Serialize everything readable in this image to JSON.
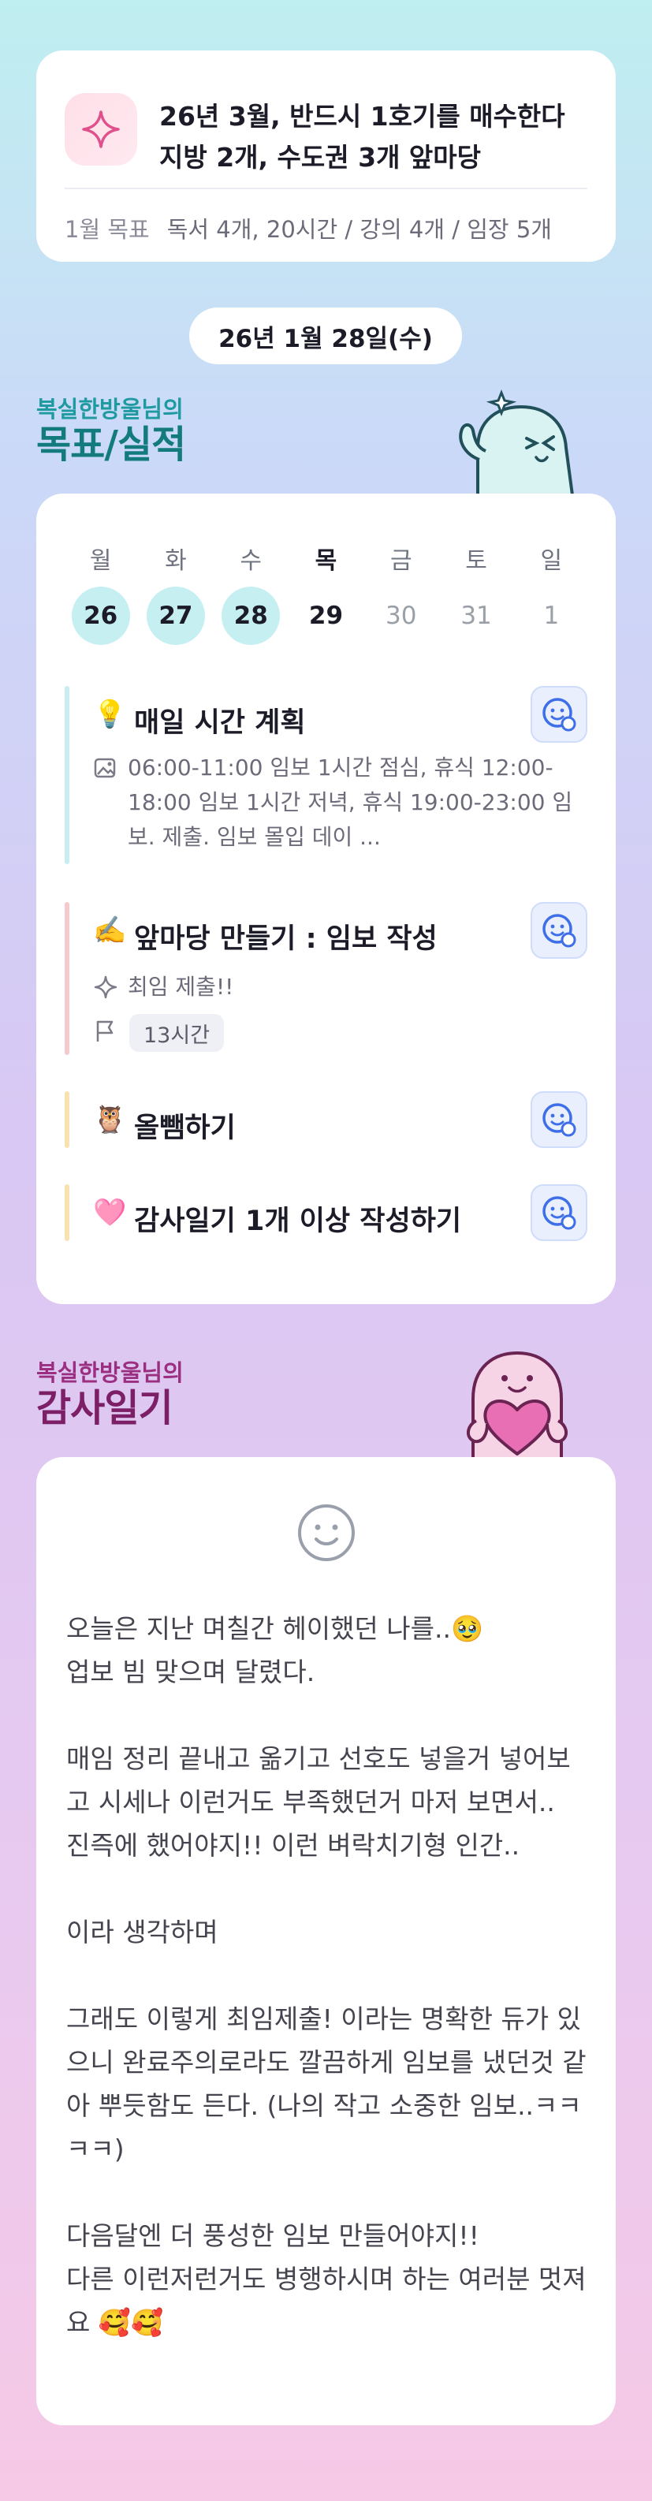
{
  "goal": {
    "icon": "sparkle-icon",
    "title": "26년 3월, 반드시 1호기를 매수한다 지방 2개, 수도권 3개 앞마당",
    "month_label": "1월 목표",
    "month_detail": "독서 4개, 20시간 / 강의 4개 / 임장 5개"
  },
  "date_label": "26년 1월 28일(수)",
  "goal_section": {
    "subtitle": "복실한방울님의",
    "title": "목표/실적"
  },
  "calendar": {
    "weekdays": [
      "월",
      "화",
      "수",
      "목",
      "금",
      "토",
      "일"
    ],
    "days": [
      "26",
      "27",
      "28",
      "29",
      "30",
      "31",
      "1"
    ]
  },
  "tasks": [
    {
      "emoji": "💡",
      "title": "매일 시간 계획",
      "desc_icon": "image-icon",
      "desc": "06:00-11:00 임보 1시간 점심, 휴식 12:00-18:00 임보 1시간 저녁, 휴식 19:00-23:00 임보. 제출. 임보 몰입 데이 ...",
      "bar_color": "#c8eef2"
    },
    {
      "emoji": "✍️",
      "title": "앞마당 만들기 : 임보 작성",
      "desc_icon": "sparkle-icon",
      "desc": "최임 제출!!",
      "tag_icon": "flag-icon",
      "tag": "13시간",
      "bar_color": "#f6c9cf"
    },
    {
      "emoji": "🦉",
      "title": "올뺌하기",
      "bar_color": "#f8e2b0"
    },
    {
      "emoji": "🩷",
      "title": "감사일기 1개 이상 작성하기",
      "bar_color": "#f8e2b0"
    }
  ],
  "thanks_section": {
    "subtitle": "복실한방울님의",
    "title": "감사일기"
  },
  "diary_text": "오늘은 지난 며칠간 헤이했던 나를..🥹\n업보 빔 맞으며 달렸다.\n\n매임 정리 끝내고 옮기고 선호도 넣을거 넣어보고 시세나 이런거도 부족했던거 마저 보면서..\n진즉에 했어야지!! 이런 벼락치기형 인간..\n\n이라 생각하며\n\n그래도 이렇게 최임제출! 이라는 명확한 듀가 있으니 완료주의로라도 깔끔하게 임보를 냈던것 같아 뿌듯함도 든다. (나의 작고 소중한 임보..ㅋㅋㅋㅋ)\n\n다음달엔 더 풍성한 임보 만들어야지!!\n다른 이런저런거도 병행하시며 하는 여러분 멋져요 🥰🥰",
  "colors": {
    "accent_teal": "#137b7e",
    "accent_plum": "#7d1f66",
    "check_blue": "#3f6fe8"
  }
}
